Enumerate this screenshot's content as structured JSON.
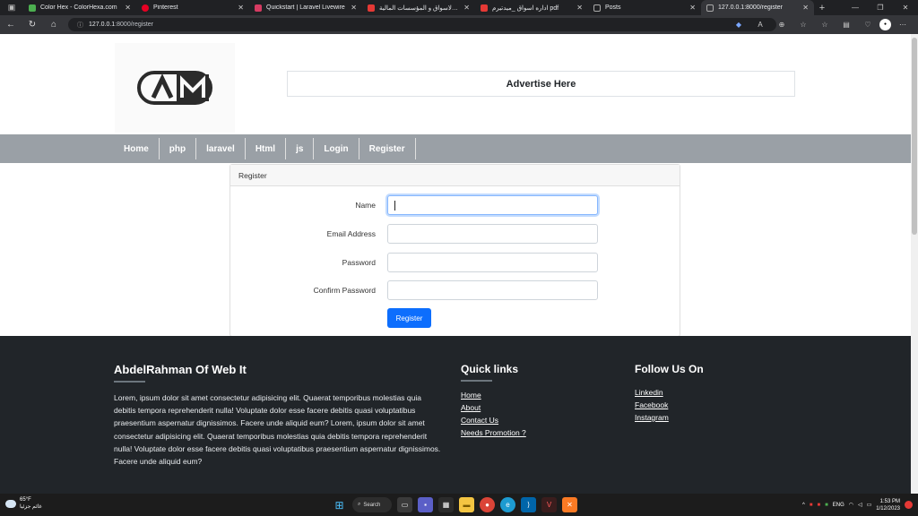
{
  "browser": {
    "tabs": [
      {
        "title": "Color Hex - ColorHexa.com",
        "color": "#4caf50"
      },
      {
        "title": "Pinterest",
        "color": "#e60023"
      },
      {
        "title": "Quickstart | Laravel Livewire",
        "color": "#d63b62"
      },
      {
        "title": "ادارةالاسواق و المؤسسات المالية",
        "color": "#e53935"
      },
      {
        "title": "اداره اسواق _ميدتيرم pdf",
        "color": "#e53935"
      },
      {
        "title": "Posts",
        "color": "#9e9e9e"
      },
      {
        "title": "127.0.0.1:8000/register",
        "color": "#9e9e9e"
      }
    ],
    "url_host": "127.0.0.1",
    "url_rest": ":8000/register"
  },
  "site": {
    "logo_text": "AM",
    "advert": "Advertise Here",
    "nav": [
      "Home",
      "php",
      "laravel",
      "Html",
      "js",
      "Login",
      "Register"
    ]
  },
  "register_form": {
    "header": "Register",
    "fields": [
      {
        "label": "Name"
      },
      {
        "label": "Email Address"
      },
      {
        "label": "Password"
      },
      {
        "label": "Confirm Password"
      }
    ],
    "submit_label": "Register"
  },
  "footer": {
    "about_title": "AbdelRahman Of Web It",
    "about_text": "Lorem, ipsum dolor sit amet consectetur adipisicing elit. Quaerat temporibus molestias quia debitis tempora reprehenderit nulla! Voluptate dolor esse facere debitis quasi voluptatibus praesentium aspernatur dignissimos. Facere unde aliquid eum? Lorem, ipsum dolor sit amet consectetur adipisicing elit. Quaerat temporibus molestias quia debitis tempora reprehenderit nulla! Voluptate dolor esse facere debitis quasi voluptatibus praesentium aspernatur dignissimos. Facere unde aliquid eum?",
    "quick_title": "Quick links",
    "quick_links": [
      "Home",
      "About",
      "Contact Us",
      "Needs Promotion ?"
    ],
    "follow_title": "Follow Us On",
    "follow_links": [
      "Linkedin",
      "Facebook",
      "Instagram"
    ]
  },
  "taskbar": {
    "temp": "65°F",
    "weather_desc": "غائم جزئيا",
    "search_label": "Search",
    "lang": "ENG",
    "time": "1:53 PM",
    "date": "1/12/2023"
  }
}
